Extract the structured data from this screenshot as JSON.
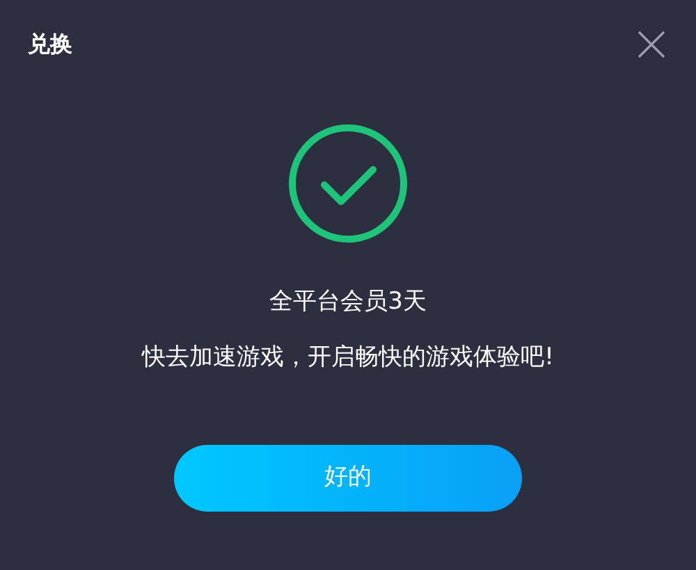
{
  "dialog": {
    "title": "兑换"
  },
  "message": {
    "headline": "全平台会员3天",
    "body": "快去加速游戏，开启畅快的游戏体验吧!"
  },
  "buttons": [
    {
      "label": "好的"
    }
  ]
}
